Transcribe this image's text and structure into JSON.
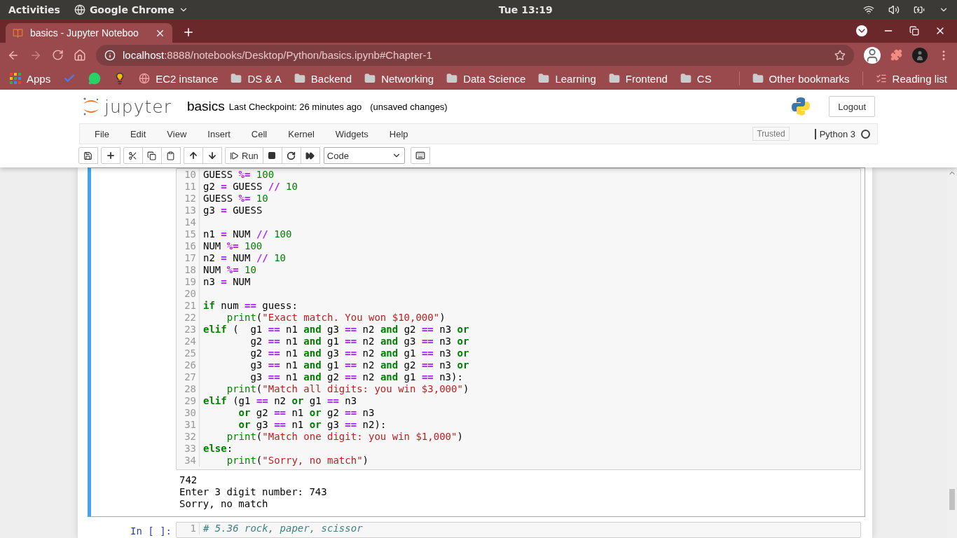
{
  "system_bar": {
    "activities": "Activities",
    "app": "Google Chrome",
    "clock": "Tue 13:19"
  },
  "browser": {
    "tab": {
      "title": "basics - Jupyter Noteboo",
      "selected": true
    },
    "address": {
      "host": "localhost",
      "path": ":8888/notebooks/Desktop/Python/basics.ipynb#Chapter-1"
    },
    "bookmarks": [
      {
        "kind": "apps",
        "label": "Apps"
      },
      {
        "kind": "check"
      },
      {
        "kind": "chat"
      },
      {
        "kind": "bulb"
      },
      {
        "kind": "globe",
        "label": "EC2 instance"
      },
      {
        "kind": "folder",
        "label": "DS & A"
      },
      {
        "kind": "folder",
        "label": "Backend"
      },
      {
        "kind": "folder",
        "label": "Networking"
      },
      {
        "kind": "folder",
        "label": "Data Science"
      },
      {
        "kind": "folder",
        "label": "Learning"
      },
      {
        "kind": "folder",
        "label": "Frontend"
      },
      {
        "kind": "folder",
        "label": "CS"
      }
    ],
    "other_bookmarks": "Other bookmarks",
    "reading_list": "Reading list"
  },
  "jupyter": {
    "logo": "jupyter",
    "notebook_name": "basics",
    "checkpoint": "Last Checkpoint: 26 minutes ago",
    "save_status": "(unsaved changes)",
    "logout": "Logout",
    "menu": [
      "File",
      "Edit",
      "View",
      "Insert",
      "Cell",
      "Kernel",
      "Widgets",
      "Help"
    ],
    "trusted": "Trusted",
    "kernel": "Python 3",
    "kernel_busy": false,
    "run_label": "Run",
    "cell_type": "Code"
  },
  "cells": [
    {
      "active": true,
      "lines": [
        {
          "no": "10",
          "tokens": [
            {
              "text": "GUESS ",
              "kind": "plain"
            },
            {
              "text": "%=",
              "kind": "op"
            },
            {
              "text": " 100",
              "kind": "num"
            }
          ]
        },
        {
          "no": "11",
          "tokens": [
            {
              "text": "g2 ",
              "kind": "plain"
            },
            {
              "text": "=",
              "kind": "op"
            },
            {
              "text": " GUESS ",
              "kind": "plain"
            },
            {
              "text": "//",
              "kind": "op"
            },
            {
              "text": " 10",
              "kind": "num"
            }
          ]
        },
        {
          "no": "12",
          "tokens": [
            {
              "text": "GUESS ",
              "kind": "plain"
            },
            {
              "text": "%=",
              "kind": "op"
            },
            {
              "text": " 10",
              "kind": "num"
            }
          ]
        },
        {
          "no": "13",
          "tokens": [
            {
              "text": "g3 ",
              "kind": "plain"
            },
            {
              "text": "=",
              "kind": "op"
            },
            {
              "text": " GUESS",
              "kind": "plain"
            }
          ]
        },
        {
          "no": "14"
        },
        {
          "no": "15",
          "tokens": [
            {
              "text": "n1 ",
              "kind": "plain"
            },
            {
              "text": "=",
              "kind": "op"
            },
            {
              "text": " NUM ",
              "kind": "plain"
            },
            {
              "text": "//",
              "kind": "op"
            },
            {
              "text": " 100",
              "kind": "num"
            }
          ]
        },
        {
          "no": "16",
          "tokens": [
            {
              "text": "NUM ",
              "kind": "plain"
            },
            {
              "text": "%=",
              "kind": "op"
            },
            {
              "text": " 100",
              "kind": "num"
            }
          ]
        },
        {
          "no": "17",
          "tokens": [
            {
              "text": "n2 ",
              "kind": "plain"
            },
            {
              "text": "=",
              "kind": "op"
            },
            {
              "text": " NUM ",
              "kind": "plain"
            },
            {
              "text": "//",
              "kind": "op"
            },
            {
              "text": " 10",
              "kind": "num"
            }
          ]
        },
        {
          "no": "18",
          "tokens": [
            {
              "text": "NUM ",
              "kind": "plain"
            },
            {
              "text": "%=",
              "kind": "op"
            },
            {
              "text": " 10",
              "kind": "num"
            }
          ]
        },
        {
          "no": "19",
          "tokens": [
            {
              "text": "n3 ",
              "kind": "plain"
            },
            {
              "text": "=",
              "kind": "op"
            },
            {
              "text": " NUM",
              "kind": "plain"
            }
          ]
        },
        {
          "no": "20"
        },
        {
          "no": "21",
          "tokens": [
            {
              "text": "if",
              "kind": "kw"
            },
            {
              "text": " num ",
              "kind": "plain"
            },
            {
              "text": "==",
              "kind": "op"
            },
            {
              "text": " guess:",
              "kind": "plain"
            }
          ]
        },
        {
          "no": "22",
          "tokens": [
            {
              "text": "    print",
              "kind": "builtin"
            },
            {
              "text": "(",
              "kind": "plain"
            },
            {
              "text": "\"Exact match. You won $10,000\"",
              "kind": "str"
            },
            {
              "text": ")",
              "kind": "plain"
            }
          ]
        },
        {
          "no": "23",
          "tokens": [
            {
              "text": "elif",
              "kind": "kw"
            },
            {
              "text": " (  g1 ",
              "kind": "plain"
            },
            {
              "text": "==",
              "kind": "op"
            },
            {
              "text": " n1 ",
              "kind": "plain"
            },
            {
              "text": "and",
              "kind": "kw"
            },
            {
              "text": " g3 ",
              "kind": "plain"
            },
            {
              "text": "==",
              "kind": "op"
            },
            {
              "text": " n2 ",
              "kind": "plain"
            },
            {
              "text": "and",
              "kind": "kw"
            },
            {
              "text": " g2 ",
              "kind": "plain"
            },
            {
              "text": "==",
              "kind": "op"
            },
            {
              "text": " n3 ",
              "kind": "plain"
            },
            {
              "text": "or",
              "kind": "kw"
            }
          ]
        },
        {
          "no": "24",
          "tokens": [
            {
              "text": "        g2 ",
              "kind": "plain"
            },
            {
              "text": "==",
              "kind": "op"
            },
            {
              "text": " n1 ",
              "kind": "plain"
            },
            {
              "text": "and",
              "kind": "kw"
            },
            {
              "text": " g1 ",
              "kind": "plain"
            },
            {
              "text": "==",
              "kind": "op"
            },
            {
              "text": " n2 ",
              "kind": "plain"
            },
            {
              "text": "and",
              "kind": "kw"
            },
            {
              "text": " g3 ",
              "kind": "plain"
            },
            {
              "text": "==",
              "kind": "op"
            },
            {
              "text": " n3 ",
              "kind": "plain"
            },
            {
              "text": "or",
              "kind": "kw"
            }
          ]
        },
        {
          "no": "25",
          "tokens": [
            {
              "text": "        g2 ",
              "kind": "plain"
            },
            {
              "text": "==",
              "kind": "op"
            },
            {
              "text": " n1 ",
              "kind": "plain"
            },
            {
              "text": "and",
              "kind": "kw"
            },
            {
              "text": " g3 ",
              "kind": "plain"
            },
            {
              "text": "==",
              "kind": "op"
            },
            {
              "text": " n2 ",
              "kind": "plain"
            },
            {
              "text": "and",
              "kind": "kw"
            },
            {
              "text": " g1 ",
              "kind": "plain"
            },
            {
              "text": "==",
              "kind": "op"
            },
            {
              "text": " n3 ",
              "kind": "plain"
            },
            {
              "text": "or",
              "kind": "kw"
            }
          ]
        },
        {
          "no": "26",
          "tokens": [
            {
              "text": "        g3 ",
              "kind": "plain"
            },
            {
              "text": "==",
              "kind": "op"
            },
            {
              "text": " n1 ",
              "kind": "plain"
            },
            {
              "text": "and",
              "kind": "kw"
            },
            {
              "text": " g1 ",
              "kind": "plain"
            },
            {
              "text": "==",
              "kind": "op"
            },
            {
              "text": " n2 ",
              "kind": "plain"
            },
            {
              "text": "and",
              "kind": "kw"
            },
            {
              "text": " g2 ",
              "kind": "plain"
            },
            {
              "text": "==",
              "kind": "op"
            },
            {
              "text": " n3 ",
              "kind": "plain"
            },
            {
              "text": "or",
              "kind": "kw"
            }
          ]
        },
        {
          "no": "27",
          "tokens": [
            {
              "text": "        g3 ",
              "kind": "plain"
            },
            {
              "text": "==",
              "kind": "op"
            },
            {
              "text": " n1 ",
              "kind": "plain"
            },
            {
              "text": "and",
              "kind": "kw"
            },
            {
              "text": " g2 ",
              "kind": "plain"
            },
            {
              "text": "==",
              "kind": "op"
            },
            {
              "text": " n2 ",
              "kind": "plain"
            },
            {
              "text": "and",
              "kind": "kw"
            },
            {
              "text": " g1 ",
              "kind": "plain"
            },
            {
              "text": "==",
              "kind": "op"
            },
            {
              "text": " n3):",
              "kind": "plain"
            }
          ]
        },
        {
          "no": "28",
          "tokens": [
            {
              "text": "    print",
              "kind": "builtin"
            },
            {
              "text": "(",
              "kind": "plain"
            },
            {
              "text": "\"Match all digits: you win $3,000\"",
              "kind": "str"
            },
            {
              "text": ")",
              "kind": "plain"
            }
          ]
        },
        {
          "no": "29",
          "tokens": [
            {
              "text": "elif",
              "kind": "kw"
            },
            {
              "text": " (g1 ",
              "kind": "plain"
            },
            {
              "text": "==",
              "kind": "op"
            },
            {
              "text": " n2 ",
              "kind": "plain"
            },
            {
              "text": "or",
              "kind": "kw"
            },
            {
              "text": " g1 ",
              "kind": "plain"
            },
            {
              "text": "==",
              "kind": "op"
            },
            {
              "text": " n3",
              "kind": "plain"
            }
          ]
        },
        {
          "no": "30",
          "tokens": [
            {
              "text": "      or",
              "kind": "kw"
            },
            {
              "text": " g2 ",
              "kind": "plain"
            },
            {
              "text": "==",
              "kind": "op"
            },
            {
              "text": " n1 ",
              "kind": "plain"
            },
            {
              "text": "or",
              "kind": "kw"
            },
            {
              "text": " g2 ",
              "kind": "plain"
            },
            {
              "text": "==",
              "kind": "op"
            },
            {
              "text": " n3",
              "kind": "plain"
            }
          ]
        },
        {
          "no": "31",
          "tokens": [
            {
              "text": "      or",
              "kind": "kw"
            },
            {
              "text": " g3 ",
              "kind": "plain"
            },
            {
              "text": "==",
              "kind": "op"
            },
            {
              "text": " n1 ",
              "kind": "plain"
            },
            {
              "text": "or",
              "kind": "kw"
            },
            {
              "text": " g3 ",
              "kind": "plain"
            },
            {
              "text": "==",
              "kind": "op"
            },
            {
              "text": " n2):",
              "kind": "plain"
            }
          ]
        },
        {
          "no": "32",
          "tokens": [
            {
              "text": "    print",
              "kind": "builtin"
            },
            {
              "text": "(",
              "kind": "plain"
            },
            {
              "text": "\"Match one digit: you win $1,000\"",
              "kind": "str"
            },
            {
              "text": ")",
              "kind": "plain"
            }
          ]
        },
        {
          "no": "33",
          "tokens": [
            {
              "text": "else",
              "kind": "kw"
            },
            {
              "text": ":",
              "kind": "plain"
            }
          ]
        },
        {
          "no": "34",
          "tokens": [
            {
              "text": "    print",
              "kind": "builtin"
            },
            {
              "text": "(",
              "kind": "plain"
            },
            {
              "text": "\"Sorry, no match\"",
              "kind": "str"
            },
            {
              "text": ")",
              "kind": "plain"
            }
          ]
        }
      ],
      "output": [
        "742",
        "Enter 3 digit number: 743",
        "Sorry, no match"
      ]
    },
    {
      "active": false,
      "prompt": "In [ ]:",
      "lines": [
        {
          "no": "1",
          "tokens": [
            {
              "text": "# 5.36 rock, paper, scissor",
              "kind": "comment"
            }
          ]
        }
      ]
    }
  ]
}
